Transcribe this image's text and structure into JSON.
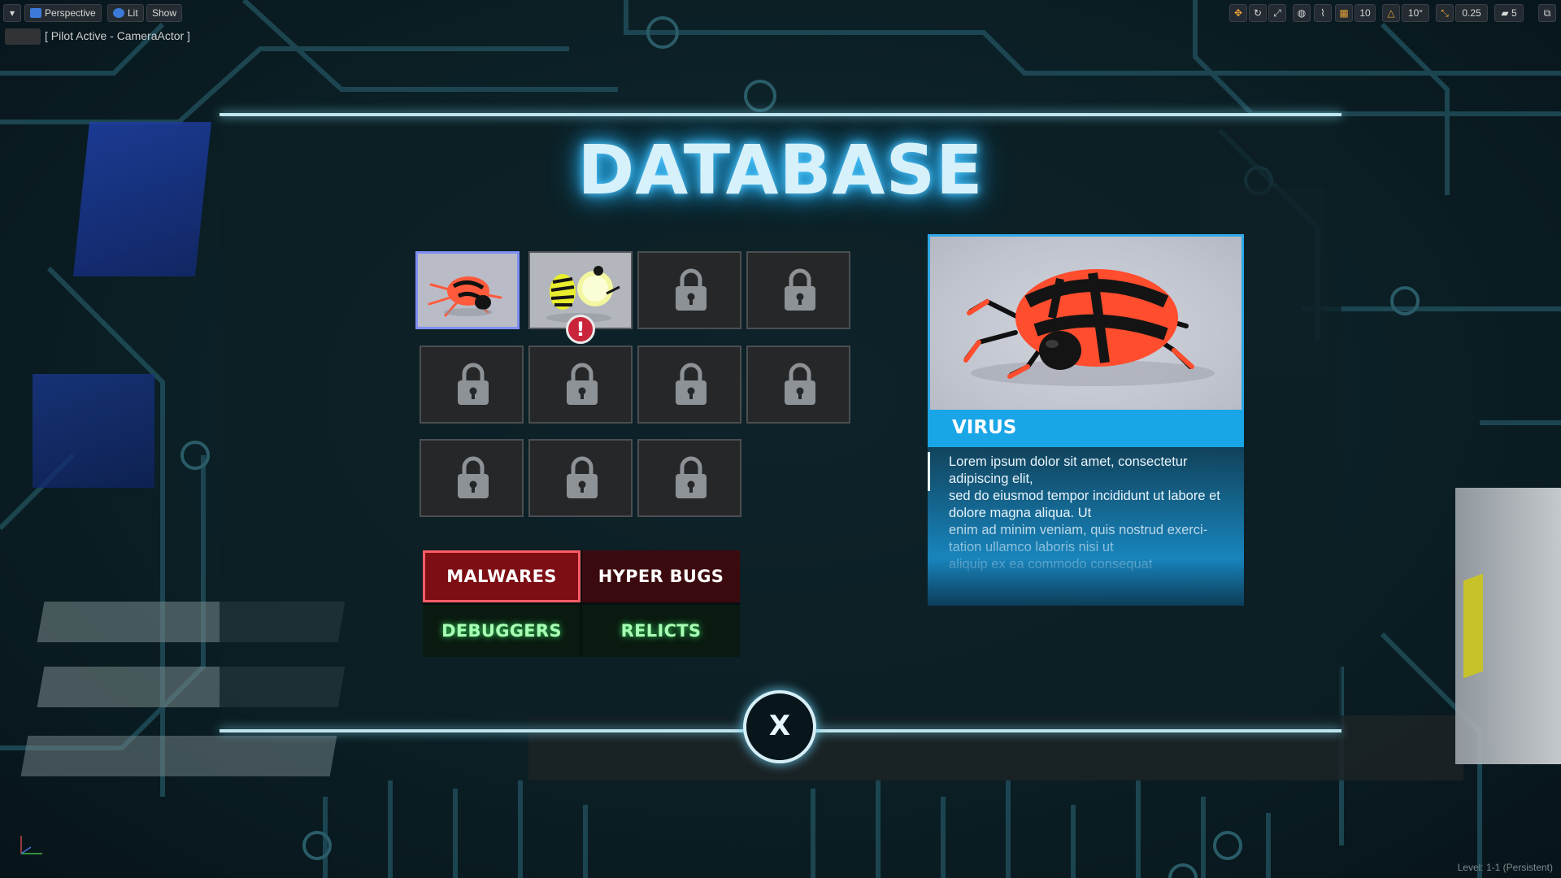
{
  "viewport": {
    "perspective_label": "Perspective",
    "lit_label": "Lit",
    "show_label": "Show",
    "grid_snap_value": "10",
    "rotation_snap_value": "10°",
    "scale_snap_value": "0.25",
    "camera_speed_value": "5",
    "pilot_label": "[ Pilot Active - CameraActor ]",
    "level_label": "Level:  1-1 (Persistent)"
  },
  "database": {
    "title": "DATABASE",
    "slots": [
      {
        "state": "selected",
        "creature": "virus-bug-icon"
      },
      {
        "state": "unlocked",
        "creature": "hyper-bug-icon",
        "alert": "!"
      },
      {
        "state": "locked"
      },
      {
        "state": "locked"
      },
      {
        "state": "locked"
      },
      {
        "state": "locked"
      },
      {
        "state": "locked"
      },
      {
        "state": "locked"
      },
      {
        "state": "locked"
      },
      {
        "state": "locked"
      },
      {
        "state": "locked"
      }
    ],
    "categories": {
      "malwares": "MALWARES",
      "hyper_bugs": "HYPER BUGS",
      "debuggers": "DEBUGGERS",
      "relicts": "RELICTS"
    },
    "selected_category": "MALWARES",
    "detail": {
      "name": "VIRUS",
      "description": "Lorem ipsum dolor sit amet, consectetur adipiscing elit,\nsed do eiusmod tempor incididunt ut labore et dolore magna aliqua. Ut\nenim ad minim veniam, quis nostrud exerci-tation ullamco laboris nisi ut\naliquip ex ea commodo consequat"
    },
    "close_label": "X"
  },
  "colors": {
    "title_glow": "#52c8ff",
    "accent_blue": "#1aa6e6",
    "malwares_red": "#7d0e14",
    "debugger_green": "#a8ffb4",
    "alert_red": "#c9243a"
  }
}
